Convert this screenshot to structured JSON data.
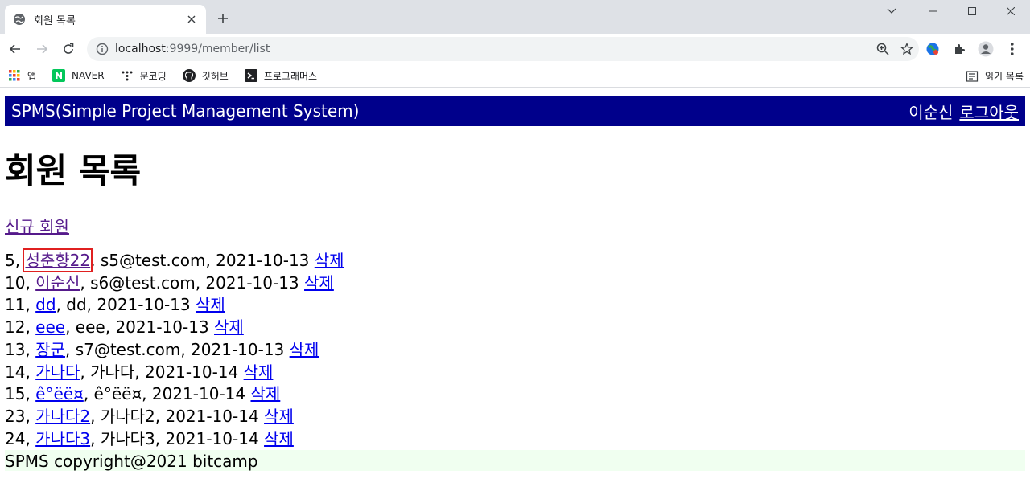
{
  "browser": {
    "tab_title": "회원 목록",
    "url_host": "localhost",
    "url_rest": ":9999/member/list",
    "bookmarks": [
      {
        "label": "앱",
        "icon": "apps-grid-icon"
      },
      {
        "label": "NAVER",
        "icon": "naver-icon"
      },
      {
        "label": "문코딩",
        "icon": "moncoding-icon"
      },
      {
        "label": "깃허브",
        "icon": "github-icon"
      },
      {
        "label": "프로그래머스",
        "icon": "programmers-icon"
      }
    ],
    "reading_list": "읽기 목록"
  },
  "header": {
    "brand": "SPMS(Simple Project Management System)",
    "user_name": "이순신",
    "logout": "로그아웃"
  },
  "page": {
    "title": "회원 목록",
    "new_member": "신규 회원"
  },
  "members": [
    {
      "no": "5,",
      "name": "성춘향22",
      "rest": ", s5@test.com, 2021-10-13",
      "delete": "삭제"
    },
    {
      "no": "10,",
      "name": "이순신",
      "rest": ", s6@test.com, 2021-10-13",
      "delete": "삭제"
    },
    {
      "no": "11,",
      "name": "dd",
      "rest": ", dd, 2021-10-13",
      "delete": "삭제"
    },
    {
      "no": "12,",
      "name": "eee",
      "rest": ", eee, 2021-10-13",
      "delete": "삭제"
    },
    {
      "no": "13,",
      "name": "장군",
      "rest": ", s7@test.com, 2021-10-13",
      "delete": "삭제"
    },
    {
      "no": "14,",
      "name": "가나다",
      "rest": ", 가나다, 2021-10-14",
      "delete": "삭제"
    },
    {
      "no": "15,",
      "name": "ê°ëë¤",
      "rest": ", ê°ëë¤, 2021-10-14",
      "delete": "삭제"
    },
    {
      "no": "23,",
      "name": "가나다2",
      "rest": ", 가나다2, 2021-10-14",
      "delete": "삭제"
    },
    {
      "no": "24,",
      "name": "가나다3",
      "rest": ", 가나다3, 2021-10-14",
      "delete": "삭제"
    }
  ],
  "footer": "SPMS copyright@2021 bitcamp",
  "colors": {
    "header_bg": "#00008b",
    "footer_bg": "#f0fff0",
    "link": "#0000ee",
    "visited": "#551a8b",
    "highlight": "#e02020"
  }
}
